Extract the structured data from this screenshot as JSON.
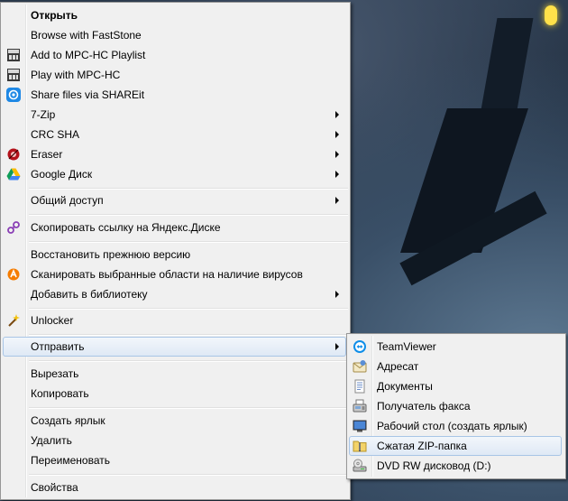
{
  "context_menu": {
    "items": [
      {
        "label": "Открыть",
        "bold": true
      },
      {
        "label": "Browse with FastStone"
      },
      {
        "label": "Add to MPC-HC Playlist",
        "icon": "mpc-hc-icon"
      },
      {
        "label": "Play with MPC-HC",
        "icon": "mpc-hc-icon"
      },
      {
        "label": "Share files via SHAREit",
        "icon": "shareit-icon"
      },
      {
        "label": "7-Zip",
        "submenu": true
      },
      {
        "label": "CRC SHA",
        "submenu": true
      },
      {
        "label": "Eraser",
        "icon": "eraser-icon",
        "submenu": true
      },
      {
        "label": "Google Диск",
        "icon": "google-drive-icon",
        "submenu": true
      },
      {
        "label": "Общий доступ",
        "submenu": true
      },
      {
        "label": "Скопировать ссылку на Яндекс.Диске",
        "icon": "link-icon"
      },
      {
        "label": "Восстановить прежнюю версию"
      },
      {
        "label": "Сканировать выбранные области на наличие вирусов",
        "icon": "avast-icon"
      },
      {
        "label": "Добавить в библиотеку",
        "submenu": true
      },
      {
        "label": "Unlocker",
        "icon": "wand-icon"
      },
      {
        "label": "Отправить",
        "submenu": true,
        "highlighted": true
      },
      {
        "label": "Вырезать"
      },
      {
        "label": "Копировать"
      },
      {
        "label": "Создать ярлык"
      },
      {
        "label": "Удалить"
      },
      {
        "label": "Переименовать"
      },
      {
        "label": "Свойства"
      }
    ]
  },
  "send_to_menu": {
    "items": [
      {
        "label": "TeamViewer",
        "icon": "teamviewer-icon"
      },
      {
        "label": "Адресат",
        "icon": "mail-recipient-icon"
      },
      {
        "label": "Документы",
        "icon": "documents-icon"
      },
      {
        "label": "Получатель факса",
        "icon": "fax-icon"
      },
      {
        "label": "Рабочий стол (создать ярлык)",
        "icon": "desktop-icon"
      },
      {
        "label": "Сжатая ZIP-папка",
        "icon": "zip-folder-icon",
        "highlighted": true
      },
      {
        "label": "DVD RW дисковод (D:)",
        "icon": "dvd-drive-icon"
      }
    ]
  },
  "colors": {
    "menu_bg": "#f0f0f0",
    "highlight_border": "#a8c5e6",
    "highlight_bg": "#dfe9f5"
  }
}
